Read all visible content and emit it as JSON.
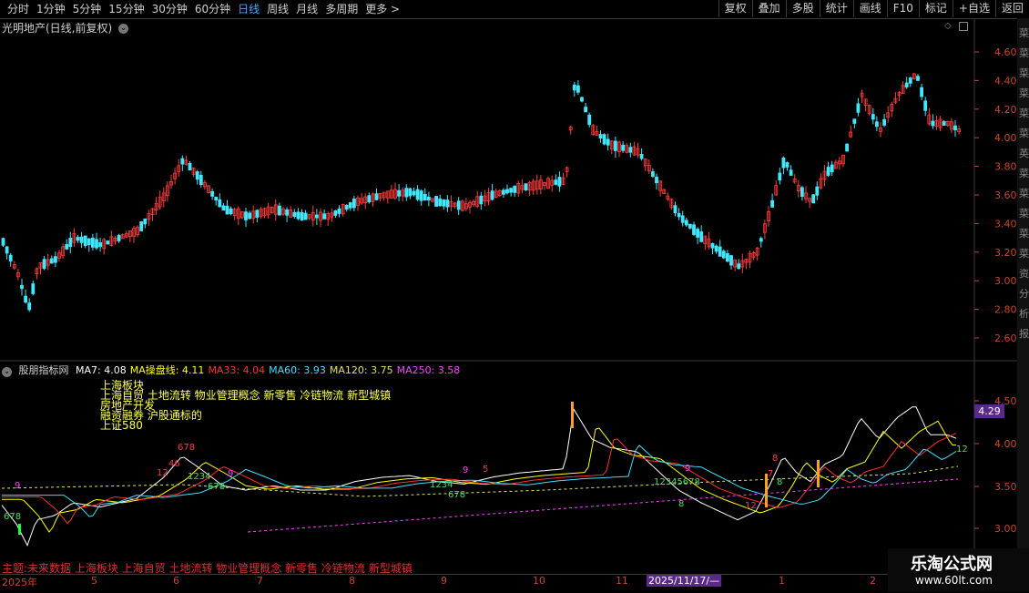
{
  "toolbar": {
    "periods": [
      "分时",
      "1分钟",
      "5分钟",
      "15分钟",
      "30分钟",
      "60分钟",
      "日线",
      "周线",
      "月线",
      "多周期",
      "更多 >"
    ],
    "active_period": "日线",
    "actions": [
      "复权",
      "叠加",
      "多股",
      "统计",
      "画线",
      "F10",
      "标记",
      "+自选",
      "返回"
    ]
  },
  "stock_title": "光明地产(日线,前复权)",
  "price_axis": [
    "4.60",
    "4.40",
    "4.20",
    "4.00",
    "3.80",
    "3.60",
    "3.40",
    "3.20",
    "3.00",
    "2.80",
    "2.60"
  ],
  "indicator": {
    "name": "股朋指标网",
    "items": [
      {
        "text": "MA7: 4.08",
        "color": "#ffffff"
      },
      {
        "text": "MA操盘线: 4.11",
        "color": "#ffff00"
      },
      {
        "text": "MA33: 4.04",
        "color": "#ff3030"
      },
      {
        "text": "MA60: 3.93",
        "color": "#40e0ff"
      },
      {
        "text": "MA120: 3.75",
        "color": "#e0e060"
      },
      {
        "text": "MA250: 3.58",
        "color": "#ff40ff"
      }
    ],
    "axis": [
      "4.50",
      "4.00",
      "3.50",
      "3.00"
    ],
    "current_price_tag": "4.29"
  },
  "concepts": {
    "line1": "上海板块",
    "line2": "上海自贸 土地流转 物业管理概念 新零售 冷链物流 新型城镇",
    "line3": "房地产开发",
    "line4": "融资融券 沪股通标的",
    "line5": "上证580"
  },
  "bottom_theme": "主题:未来数据  上海板块 上海自贸 土地流转 物业管理概念 新零售 冷链物流 新型城镇",
  "dates": [
    "2025年",
    "5",
    "6",
    "7",
    "8",
    "9",
    "10",
    "11",
    "1",
    "2"
  ],
  "cursor_date": "2025/11/17/—",
  "watermark": {
    "brand": "乐淘公式网",
    "url": "www.60lt.com"
  },
  "side_letters": [
    "菜",
    "菜",
    "菜",
    "菜",
    "菜",
    "菜",
    "英",
    "菜",
    "菜",
    "菜",
    "菜",
    "菜",
    "资",
    "分",
    "析",
    "报"
  ],
  "seq_labels": {
    "red": [
      "12",
      "46",
      "678",
      "5",
      "8",
      "7",
      "12"
    ],
    "green": [
      "678",
      "1234",
      "678",
      "1234",
      "678",
      "8",
      "12345678",
      "8",
      "12"
    ],
    "magenta": [
      "9",
      "9",
      "9",
      "9"
    ]
  }
}
